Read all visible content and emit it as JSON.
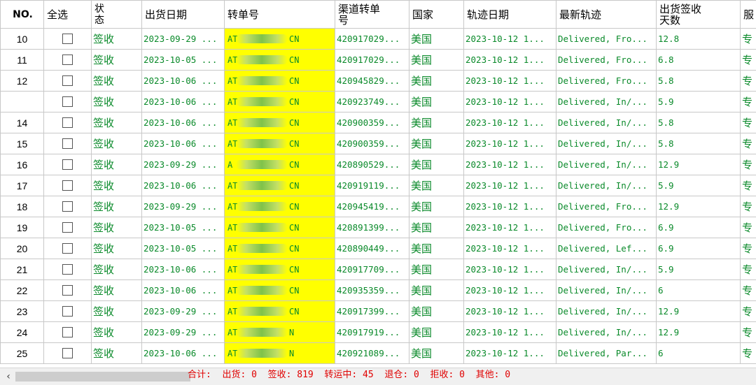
{
  "columns": {
    "no": "NO.",
    "select_all": "全选",
    "status": "状\n态",
    "ship_date": "出货日期",
    "transfer_no": "转单号",
    "channel_transfer_no": "渠道转单\n号",
    "country": "国家",
    "track_date": "轨迹日期",
    "latest_track": "最新轨迹",
    "ship_sign_days": "出货签收\n天数",
    "service": "服"
  },
  "rows": [
    {
      "no": "10",
      "status": "签收",
      "ship_date": "2023-09-29 ...",
      "tracking_prefix": "AT",
      "tracking_suffix": "CN",
      "channel_no": "420917029...",
      "country": "美国",
      "track_date": "2023-10-12 1...",
      "latest": "Delivered, Fro...",
      "days": "12.8",
      "service": "专"
    },
    {
      "no": "11",
      "status": "签收",
      "ship_date": "2023-10-05 ...",
      "tracking_prefix": "AT",
      "tracking_suffix": "CN",
      "channel_no": "420917029...",
      "country": "美国",
      "track_date": "2023-10-12 1...",
      "latest": "Delivered, Fro...",
      "days": "6.8",
      "service": "专"
    },
    {
      "no": "12",
      "status": "签收",
      "ship_date": "2023-10-06 ...",
      "tracking_prefix": "AT",
      "tracking_suffix": "CN",
      "channel_no": "420945829...",
      "country": "美国",
      "track_date": "2023-10-12 1...",
      "latest": "Delivered, Fro...",
      "days": "5.8",
      "service": "专"
    },
    {
      "no": "",
      "status": "签收",
      "ship_date": "2023-10-06 ...",
      "tracking_prefix": "AT",
      "tracking_suffix": "CN",
      "channel_no": "420923749...",
      "country": "美国",
      "track_date": "2023-10-12 1...",
      "latest": "Delivered, In/...",
      "days": "5.9",
      "service": "专"
    },
    {
      "no": "14",
      "status": "签收",
      "ship_date": "2023-10-06 ...",
      "tracking_prefix": "AT",
      "tracking_suffix": "CN",
      "channel_no": "420900359...",
      "country": "美国",
      "track_date": "2023-10-12 1...",
      "latest": "Delivered, In/...",
      "days": "5.8",
      "service": "专"
    },
    {
      "no": "15",
      "status": "签收",
      "ship_date": "2023-10-06 ...",
      "tracking_prefix": "AT",
      "tracking_suffix": "CN",
      "channel_no": "420900359...",
      "country": "美国",
      "track_date": "2023-10-12 1...",
      "latest": "Delivered, In/...",
      "days": "5.8",
      "service": "专"
    },
    {
      "no": "16",
      "status": "签收",
      "ship_date": "2023-09-29 ...",
      "tracking_prefix": "A",
      "tracking_suffix": "CN",
      "channel_no": "420890529...",
      "country": "美国",
      "track_date": "2023-10-12 1...",
      "latest": "Delivered, In/...",
      "days": "12.9",
      "service": "专"
    },
    {
      "no": "17",
      "status": "签收",
      "ship_date": "2023-10-06 ...",
      "tracking_prefix": "AT",
      "tracking_suffix": "CN",
      "channel_no": "420919119...",
      "country": "美国",
      "track_date": "2023-10-12 1...",
      "latest": "Delivered, In/...",
      "days": "5.9",
      "service": "专"
    },
    {
      "no": "18",
      "status": "签收",
      "ship_date": "2023-09-29 ...",
      "tracking_prefix": "AT",
      "tracking_suffix": "CN",
      "channel_no": "420945419...",
      "country": "美国",
      "track_date": "2023-10-12 1...",
      "latest": "Delivered, Fro...",
      "days": "12.9",
      "service": "专"
    },
    {
      "no": "19",
      "status": "签收",
      "ship_date": "2023-10-05 ...",
      "tracking_prefix": "AT",
      "tracking_suffix": "CN",
      "channel_no": "420891399...",
      "country": "美国",
      "track_date": "2023-10-12 1...",
      "latest": "Delivered, Fro...",
      "days": "6.9",
      "service": "专"
    },
    {
      "no": "20",
      "status": "签收",
      "ship_date": "2023-10-05 ...",
      "tracking_prefix": "AT",
      "tracking_suffix": "CN",
      "channel_no": "420890449...",
      "country": "美国",
      "track_date": "2023-10-12 1...",
      "latest": "Delivered, Lef...",
      "days": "6.9",
      "service": "专"
    },
    {
      "no": "21",
      "status": "签收",
      "ship_date": "2023-10-06 ...",
      "tracking_prefix": "AT",
      "tracking_suffix": "CN",
      "channel_no": "420917709...",
      "country": "美国",
      "track_date": "2023-10-12 1...",
      "latest": "Delivered, In/...",
      "days": "5.9",
      "service": "专"
    },
    {
      "no": "22",
      "status": "签收",
      "ship_date": "2023-10-06 ...",
      "tracking_prefix": "AT",
      "tracking_suffix": "CN",
      "channel_no": "420935359...",
      "country": "美国",
      "track_date": "2023-10-12 1...",
      "latest": "Delivered, In/...",
      "days": "6",
      "service": "专"
    },
    {
      "no": "23",
      "status": "签收",
      "ship_date": "2023-09-29 ...",
      "tracking_prefix": "AT",
      "tracking_suffix": "CN",
      "channel_no": "420917399...",
      "country": "美国",
      "track_date": "2023-10-12 1...",
      "latest": "Delivered, In/...",
      "days": "12.9",
      "service": "专"
    },
    {
      "no": "24",
      "status": "签收",
      "ship_date": "2023-09-29 ...",
      "tracking_prefix": "AT",
      "tracking_suffix": "N",
      "channel_no": "420917919...",
      "country": "美国",
      "track_date": "2023-10-12 1...",
      "latest": "Delivered, In/...",
      "days": "12.9",
      "service": "专"
    },
    {
      "no": "25",
      "status": "签收",
      "ship_date": "2023-10-06 ...",
      "tracking_prefix": "AT",
      "tracking_suffix": "N",
      "channel_no": "420921089...",
      "country": "美国",
      "track_date": "2023-10-12 1...",
      "latest": "Delivered, Par...",
      "days": "6",
      "service": "专"
    }
  ],
  "summary": "合计:  出货: 0  签收: 819  转运中: 45  退仓: 0  拒收: 0  其他: 0",
  "colors": {
    "status_green": "#0a8a2a",
    "tracking_highlight": "#ffff00",
    "summary_red": "#e00000"
  },
  "icons": {
    "scroll_left": "chevron-left-icon"
  }
}
